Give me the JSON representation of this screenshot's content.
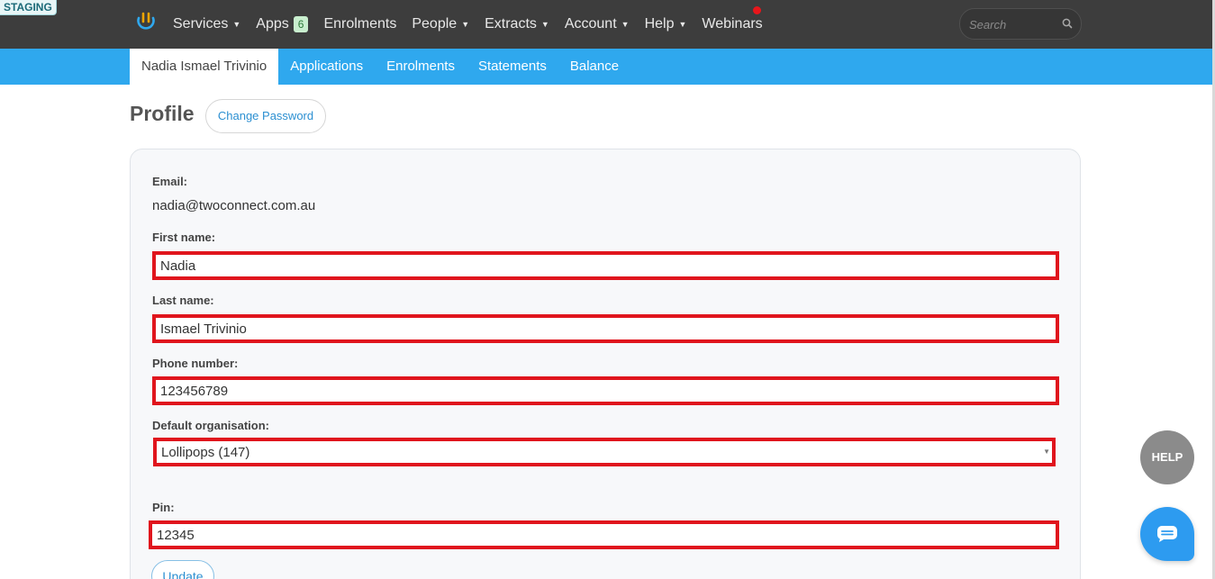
{
  "env_badge": "STAGING",
  "nav": {
    "items": [
      {
        "label": "Services",
        "dropdown": true
      },
      {
        "label": "Apps",
        "badge": "6"
      },
      {
        "label": "Enrolments"
      },
      {
        "label": "People",
        "dropdown": true
      },
      {
        "label": "Extracts",
        "dropdown": true
      },
      {
        "label": "Account",
        "dropdown": true
      },
      {
        "label": "Help",
        "dropdown": true
      },
      {
        "label": "Webinars",
        "notification": true
      }
    ],
    "search_placeholder": "Search"
  },
  "subnav": {
    "tabs": [
      {
        "label": "Nadia Ismael Trivinio",
        "active": true
      },
      {
        "label": "Applications"
      },
      {
        "label": "Enrolments"
      },
      {
        "label": "Statements"
      },
      {
        "label": "Balance"
      }
    ]
  },
  "profile": {
    "title": "Profile",
    "change_password": "Change Password",
    "email_label": "Email:",
    "email_value": "nadia@twoconnect.com.au",
    "first_name_label": "First name:",
    "first_name_value": "Nadia",
    "last_name_label": "Last name:",
    "last_name_value": "Ismael Trivinio",
    "phone_label": "Phone number:",
    "phone_value": "123456789",
    "org_label": "Default organisation:",
    "org_value": "Lollipops (147)",
    "pin_label": "Pin:",
    "pin_value": "12345",
    "update_label": "Update"
  },
  "help_label": "HELP",
  "colors": {
    "topbar": "#3d3d3d",
    "subnav": "#2fa8ee",
    "highlight": "#e0151d",
    "link": "#2b8fd1"
  }
}
